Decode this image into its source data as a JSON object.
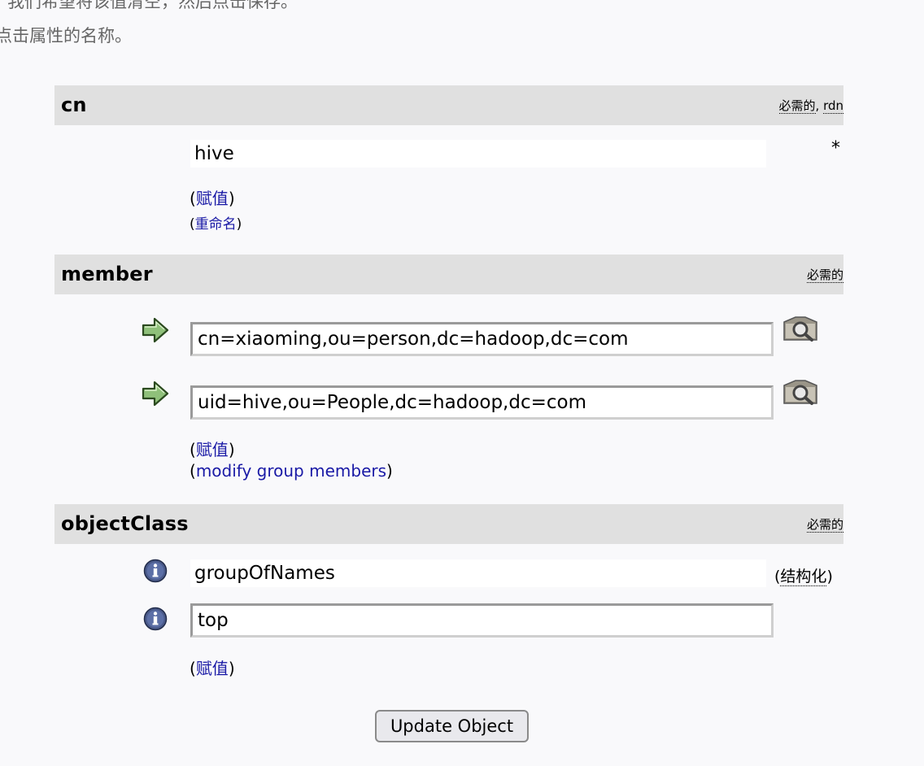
{
  "intro": {
    "line1": "，我们希望将该值清空，然后点击保存。",
    "line2": "点击属性的名称。"
  },
  "attributes": {
    "cn": {
      "name": "cn",
      "flags": {
        "required": "必需的",
        "sep": ", ",
        "rdn": "rdn"
      },
      "value": "hive",
      "required_marker": "*",
      "add_value": {
        "open": "(",
        "label": "赋值",
        "close": ")"
      },
      "rename": {
        "open": "(",
        "label": "重命名",
        "close": ")"
      }
    },
    "member": {
      "name": "member",
      "flags": {
        "required": "必需的"
      },
      "values": [
        "cn=xiaoming,ou=person,dc=hadoop,dc=com",
        "uid=hive,ou=People,dc=hadoop,dc=com"
      ],
      "add_value": {
        "open": "(",
        "label": "赋值",
        "close": ")"
      },
      "modify": {
        "open": "(",
        "label": "modify group members",
        "close": ")"
      }
    },
    "objectClass": {
      "name": "objectClass",
      "flags": {
        "required": "必需的"
      },
      "values": [
        "groupOfNames",
        "top"
      ],
      "structural": {
        "open": "(",
        "label": "结构化",
        "close": ")"
      },
      "add_value": {
        "open": "(",
        "label": "赋值",
        "close": ")"
      }
    }
  },
  "update_button": "Update Object",
  "icons": {
    "arrow": "right-arrow-icon",
    "search": "magnifier-icon",
    "info": "info-icon"
  },
  "colors": {
    "header_bg": "#e0e0e0",
    "link": "#1a1aa6",
    "page_bg": "#f9f9fb"
  }
}
